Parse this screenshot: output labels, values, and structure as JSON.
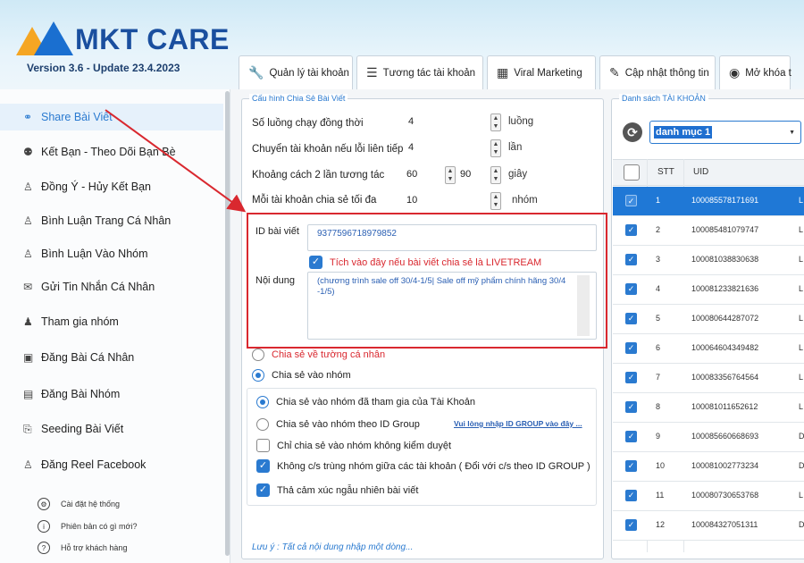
{
  "app": {
    "brand": "MKT CARE",
    "version": "Version 3.6 - Update 23.4.2023"
  },
  "tabs": [
    {
      "label": "Quản lý tài khoản",
      "icon": "wrench-icon"
    },
    {
      "label": "Tương tác tài khoản",
      "icon": "list-icon"
    },
    {
      "label": "Viral Marketing",
      "icon": "grid-icon"
    },
    {
      "label": "Cập nhật thông tin",
      "icon": "pencil-icon"
    },
    {
      "label": "Mở khóa t",
      "icon": "account-icon"
    }
  ],
  "sidebar": {
    "items": [
      {
        "label": "Share Bài Viết",
        "icon": "share-icon",
        "active": true
      },
      {
        "label": "Kết Bạn - Theo Dõi Bạn Bè",
        "icon": "users-icon"
      },
      {
        "label": "Đồng Ý - Hủy Kết Bạn",
        "icon": "user-check-icon"
      },
      {
        "label": "Bình Luận Trang Cá Nhân",
        "icon": "comment-user-icon"
      },
      {
        "label": "Bình Luận Vào Nhóm",
        "icon": "comment-group-icon"
      },
      {
        "label": "Gửi Tin Nhắn Cá Nhân",
        "icon": "message-icon"
      },
      {
        "label": "Tham gia nhóm",
        "icon": "join-group-icon"
      },
      {
        "label": "Đăng Bài Cá Nhân",
        "icon": "post-icon"
      },
      {
        "label": "Đăng Bài Nhóm",
        "icon": "group-post-icon"
      },
      {
        "label": "Seeding Bài Viết",
        "icon": "seeding-icon"
      },
      {
        "label": "Đăng Reel Facebook",
        "icon": "reel-icon"
      }
    ],
    "sub_items": [
      {
        "label": "Cài đặt hệ thống",
        "icon": "settings-icon"
      },
      {
        "label": "Phiên bản có gì mới?",
        "icon": "info-icon"
      },
      {
        "label": "Hỗ trợ khách hàng",
        "icon": "support-icon"
      }
    ]
  },
  "config": {
    "legend": "Cấu hình Chia Sẻ Bài Viết",
    "threads_label": "Số luồng chạy đồng thời",
    "threads_value": "4",
    "threads_unit": "luồng",
    "switch_label": "Chuyển tài khoản nếu lỗi liên tiếp",
    "switch_value": "4",
    "switch_unit": "lần",
    "interval_label": "Khoảng cách 2 lần tương tác",
    "interval_from": "60",
    "interval_to": "90",
    "interval_unit": "giây",
    "max_label": "Mỗi tài khoản chia sẻ tối đa",
    "max_value": "10",
    "max_unit": "nhóm",
    "post_id_label": "ID bài viết",
    "post_id_value": "9377596718979852",
    "livestream_label": "Tích vào đây nếu bài viết chia sẻ là LIVETREAM",
    "content_label": "Nội dung",
    "content_value": "(chương trình sale off 30/4-1/5| Sale off mỹ phẩm chính hãng 30/4 -1/5)",
    "share_personal": "Chia sẻ về tường cá nhân",
    "share_group": "Chia sẻ vào nhóm",
    "opt_joined": "Chia sẻ vào nhóm đã tham gia của Tài Khoản",
    "opt_by_id": "Chia sẻ vào nhóm theo ID Group",
    "opt_by_id_link": "Vui lòng nhập ID GROUP vào đây ...",
    "opt_no_approval": "Chỉ chia sẻ vào nhóm không kiểm duyệt",
    "opt_no_dup": "Không c/s trùng nhóm giữa các tài khoản ( Đổi với c/s theo ID GROUP )",
    "opt_reaction": "Thả cảm xúc ngẫu nhiên bài viết",
    "note": "Lưu ý : Tất cả nội dung nhập một dòng..."
  },
  "accounts": {
    "legend": "Danh sách TÀI KHOẢN",
    "category": "danh mục 1",
    "columns": [
      "STT",
      "UID"
    ],
    "rows": [
      {
        "stt": "1",
        "uid": "100085578171691",
        "extra": "L",
        "selected": true
      },
      {
        "stt": "2",
        "uid": "100085481079747",
        "extra": "L"
      },
      {
        "stt": "3",
        "uid": "100081038830638",
        "extra": "L"
      },
      {
        "stt": "4",
        "uid": "100081233821636",
        "extra": "L"
      },
      {
        "stt": "5",
        "uid": "100080644287072",
        "extra": "L"
      },
      {
        "stt": "6",
        "uid": "100064604349482",
        "extra": "L"
      },
      {
        "stt": "7",
        "uid": "100083356764564",
        "extra": "L"
      },
      {
        "stt": "8",
        "uid": "100081011652612",
        "extra": "L"
      },
      {
        "stt": "9",
        "uid": "100085660668693",
        "extra": "D"
      },
      {
        "stt": "10",
        "uid": "100081002773234",
        "extra": "D"
      },
      {
        "stt": "11",
        "uid": "100080730653768",
        "extra": "L"
      },
      {
        "stt": "12",
        "uid": "100084327051311",
        "extra": "D"
      }
    ]
  },
  "colors": {
    "accent": "#2a7ad0",
    "highlight": "#d9282f",
    "selected_row": "#1f78d6"
  }
}
